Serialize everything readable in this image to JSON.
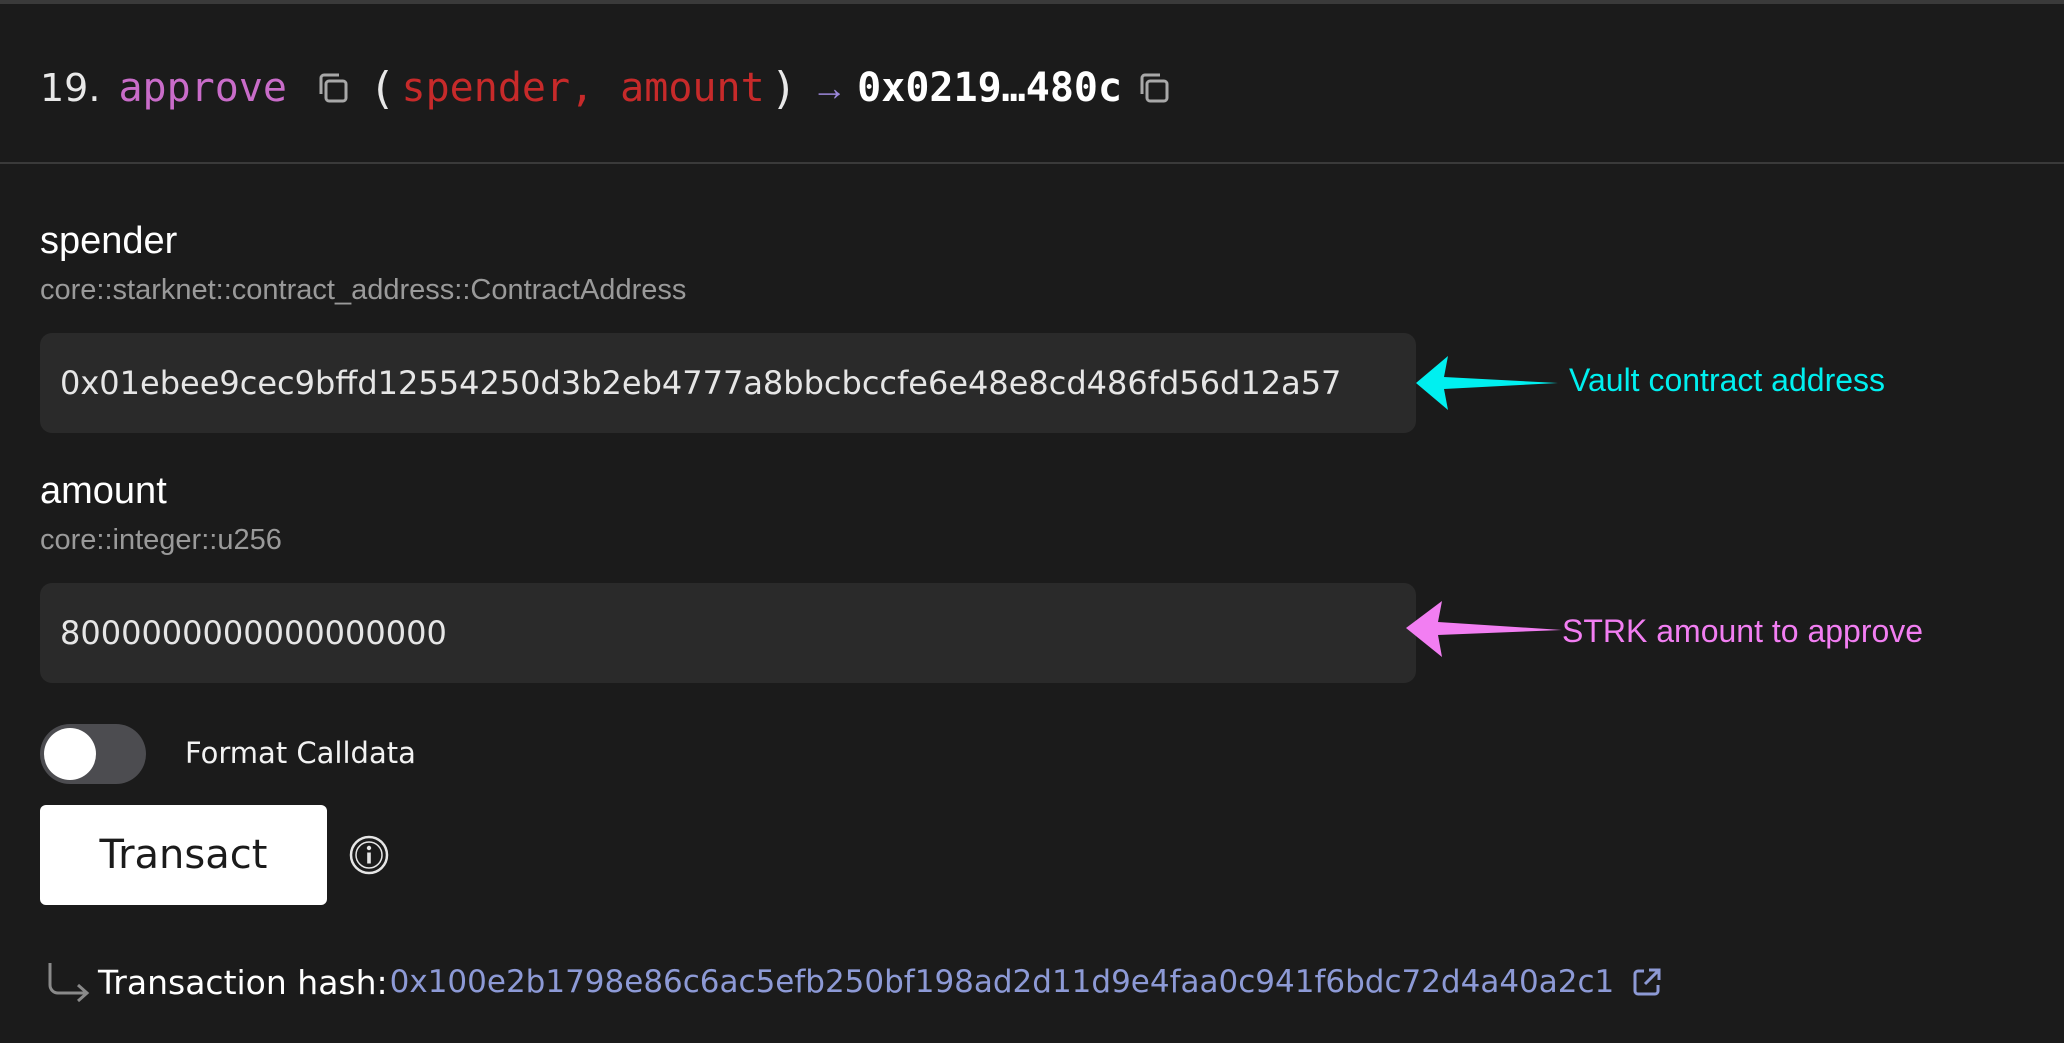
{
  "function": {
    "index": "19.",
    "name": "approve",
    "open_paren": "(",
    "params": [
      "spender,",
      "amount"
    ],
    "close_paren": ")",
    "arrow": "→",
    "return_value": "0x0219…480c"
  },
  "inputs": [
    {
      "label": "spender",
      "type": "core::starknet::contract_address::ContractAddress",
      "value": "0x01ebee9cec9bffd12554250d3b2eb4777a8bbcbccfe6e48e8cd486fd56d12a57"
    },
    {
      "label": "amount",
      "type": "core::integer::u256",
      "value": "8000000000000000000"
    }
  ],
  "annotations": [
    {
      "text": "Vault contract address",
      "color": "#00f0f0"
    },
    {
      "text": "STRK amount to approve",
      "color": "#f27ef2"
    }
  ],
  "toggle": {
    "label": "Format Calldata",
    "on": false
  },
  "transact": {
    "label": "Transact"
  },
  "transaction": {
    "label": "Transaction hash:",
    "hash": "0x100e2b1798e86c6ac5efb250bf198ad2d11d9e4faa0c941f6bdc72d4a40a2c1"
  },
  "colors": {
    "background": "#1b1b1b",
    "input_bg": "#2a2a2a",
    "function_name": "#c96cc9",
    "param": "#c72a2a",
    "link": "#8d9ad6"
  }
}
